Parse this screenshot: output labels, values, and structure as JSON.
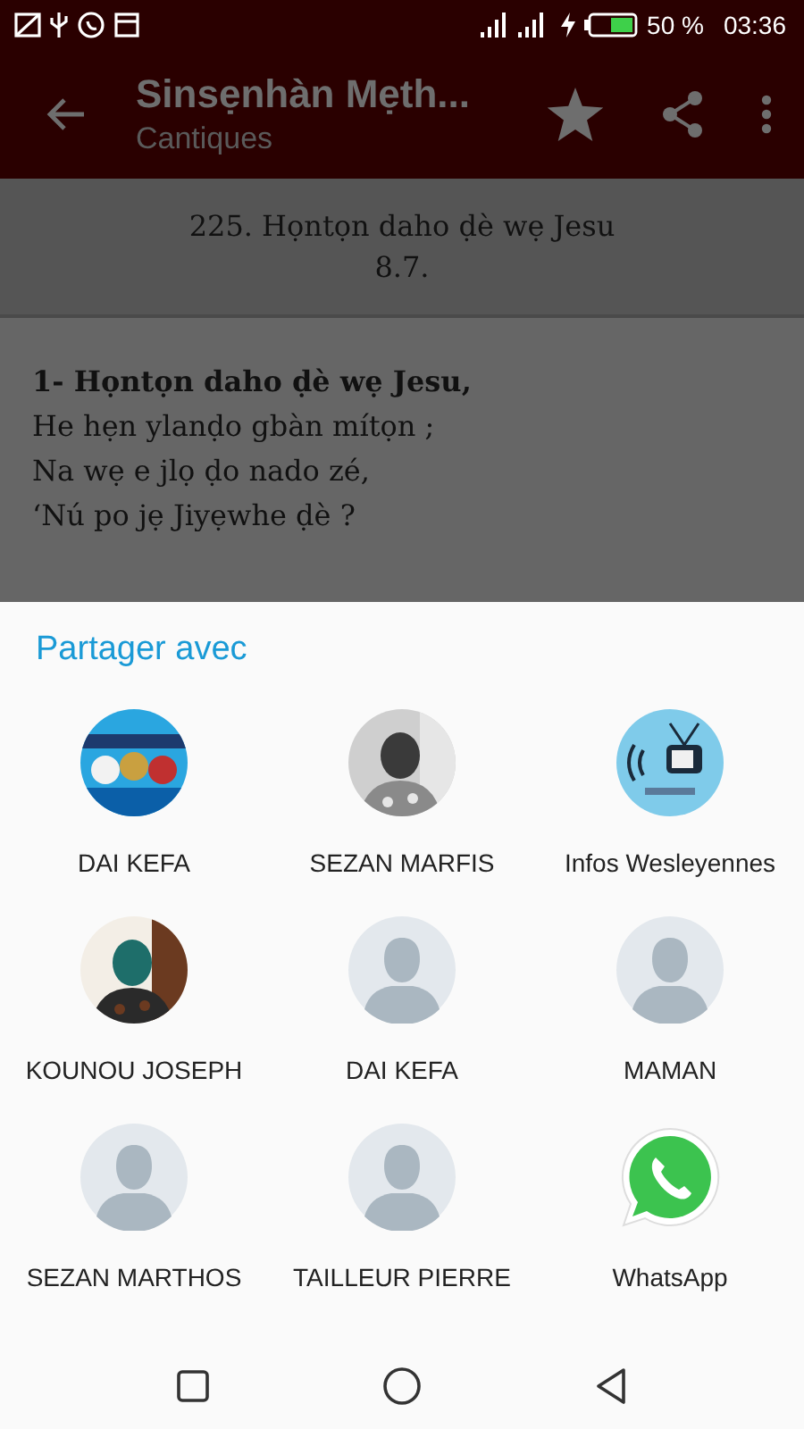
{
  "status_bar": {
    "battery": "50 %",
    "time": "03:36"
  },
  "app_bar": {
    "title": "Sinsẹnhàn Mẹth...",
    "subtitle": "Cantiques"
  },
  "song": {
    "title": "225. Họntọn daho ḍè wẹ Jesu",
    "meter": "8.7.",
    "verse_heading": "1- Họntọn daho ḍè wẹ Jesu,",
    "lines": [
      "He hẹn ylanḍo gbàn mítọn ;",
      "Na wẹ e jlọ ḍo nado zé,",
      "‘Nú po jẹ Jiyẹwhe ḍè ?"
    ]
  },
  "share_sheet": {
    "title": "Partager avec",
    "targets": [
      {
        "name": "DAI KEFA"
      },
      {
        "name": "SEZAN MARFIS"
      },
      {
        "name": "Infos Wesleyennes"
      },
      {
        "name": "KOUNOU JOSEPH"
      },
      {
        "name": "DAI KEFA",
        "kind": "placeholder"
      },
      {
        "name": "MAMAN",
        "kind": "placeholder"
      },
      {
        "name": "SEZAN MARTHOS",
        "kind": "placeholder"
      },
      {
        "name": "TAILLEUR PIERRE",
        "kind": "placeholder"
      },
      {
        "name": "WhatsApp",
        "kind": "app"
      }
    ]
  }
}
